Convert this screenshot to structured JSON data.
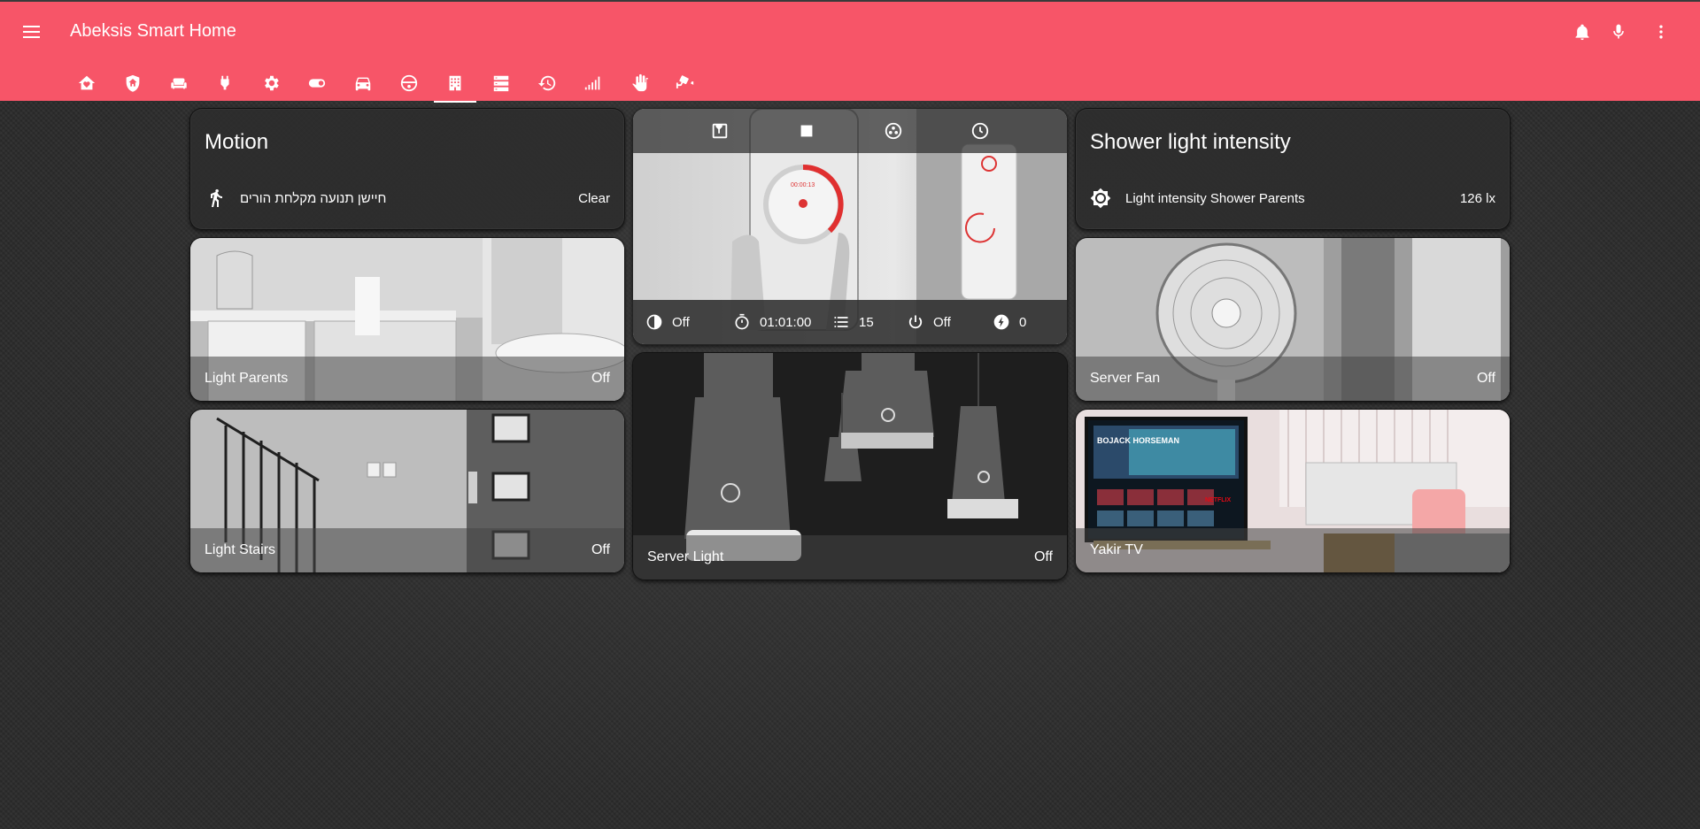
{
  "header": {
    "title": "Abeksis Smart Home",
    "menu_icon": "menu-icon",
    "actions": [
      "bell-icon",
      "microphone-icon",
      "dots-vertical-icon"
    ],
    "tabs": [
      {
        "icon": "home-heart-icon"
      },
      {
        "icon": "shield-home-icon"
      },
      {
        "icon": "sofa-icon"
      },
      {
        "icon": "power-plug-icon"
      },
      {
        "icon": "gear-icon"
      },
      {
        "icon": "toggle-switch-icon"
      },
      {
        "icon": "car-icon"
      },
      {
        "icon": "robot-vacuum-icon"
      },
      {
        "icon": "office-building-icon",
        "active": true
      },
      {
        "icon": "server-icon"
      },
      {
        "icon": "history-icon"
      },
      {
        "icon": "signal-icon"
      },
      {
        "icon": "hand-icon"
      },
      {
        "icon": "cctv-icon"
      }
    ]
  },
  "cards": {
    "motion": {
      "title": "Motion",
      "entity_name": "חיישן תנועה מקלחת הורים",
      "entity_state": "Clear",
      "icon": "walk-icon"
    },
    "vacuum": {
      "buttons": [
        "home-map-icon",
        "stop-icon",
        "fan-icon",
        "clock-icon"
      ],
      "attributes": [
        {
          "icon": "brightness-icon",
          "value": "Off"
        },
        {
          "icon": "timer-icon",
          "value": "01:01:00"
        },
        {
          "icon": "list-icon",
          "value": "15"
        },
        {
          "icon": "power-icon",
          "value": "Off"
        },
        {
          "icon": "flash-icon",
          "value": "0"
        }
      ],
      "phone_timer": "00:00:13"
    },
    "shower": {
      "title": "Shower light intensity",
      "entity_name": "Light intensity Shower Parents",
      "entity_state": "126 lx",
      "icon": "brightness-icon"
    },
    "light_parents": {
      "name": "Light Parents",
      "state": "Off"
    },
    "server_fan": {
      "name": "Server Fan",
      "state": "Off"
    },
    "light_stairs": {
      "name": "Light Stairs",
      "state": "Off"
    },
    "server_light": {
      "name": "Server Light",
      "state": "Off"
    },
    "yakir_tv": {
      "name": "Yakir TV",
      "state": "",
      "tv_show": "BOJACK HORSEMAN",
      "brand": "NETFLIX"
    }
  },
  "colors": {
    "accent": "#f75568",
    "card_bg": "#2d2d2d",
    "vacuum_ring": "#e03030"
  }
}
